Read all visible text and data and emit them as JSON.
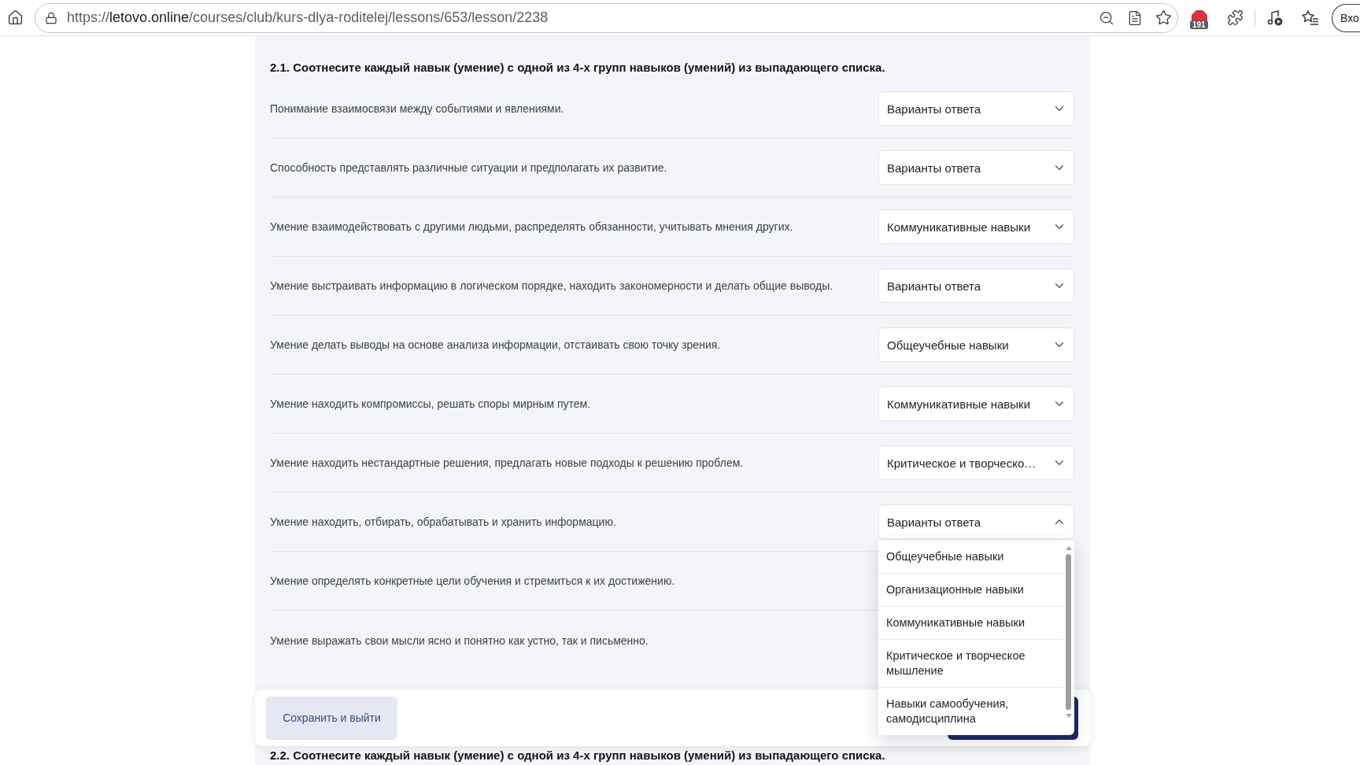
{
  "browser": {
    "url": {
      "scheme": "https://",
      "host": "letovo.online",
      "path": "/courses/club/kurs-dlya-roditelej/lessons/653/lesson/2238"
    },
    "extension_badge": "191",
    "profile_button": "Вхо"
  },
  "section": {
    "title": "2.1. Соотнесите каждый навык (умение) с одной из 4-х групп навыков (умений) из выпадающего списка.",
    "rows": [
      {
        "text": "Понимание взаимосвязи между событиями и явлениями.",
        "select": {
          "value": "Варианты ответа",
          "expanded": false
        }
      },
      {
        "text": "Способность представлять различные ситуации и предполагать их развитие.",
        "select": {
          "value": "Варианты ответа",
          "expanded": false
        }
      },
      {
        "text": "Умение взаимодействовать с другими людьми, распределять обязанности, учитывать мнения других.",
        "select": {
          "value": "Коммуникативные навыки",
          "expanded": false
        }
      },
      {
        "text": "Умение выстраивать информацию в логическом порядке, находить закономерности и делать общие выводы.",
        "select": {
          "value": "Варианты ответа",
          "expanded": false
        }
      },
      {
        "text": "Умение делать выводы на основе анализа информации, отстаивать свою точку зрения.",
        "select": {
          "value": "Общеучебные навыки",
          "expanded": false
        }
      },
      {
        "text": "Умение находить компромиссы, решать споры мирным путем.",
        "select": {
          "value": "Коммуникативные навыки",
          "expanded": false
        }
      },
      {
        "text": "Умение находить нестандартные решения, предлагать новые подходы к решению проблем.",
        "select": {
          "value": "Критическое и творческо…",
          "expanded": false
        }
      },
      {
        "text": "Умение находить, отбирать, обрабатывать и хранить информацию.",
        "select": {
          "value": "Варианты ответа",
          "expanded": true,
          "options": [
            {
              "label": "Общеучебные навыки",
              "selected": false
            },
            {
              "label": "Организационные навыки",
              "selected": false
            },
            {
              "label": "Коммуникативные навыки",
              "selected": false
            },
            {
              "label": "Критическое и творческое мышление",
              "selected": false
            },
            {
              "label": "Навыки самообучения, самодисциплина",
              "selected": false
            }
          ]
        }
      },
      {
        "text": "Умение определять конкретные цели обучения и стремиться к их достижению."
      },
      {
        "text": "Умение выражать свои мысли ясно и понятно как устно, так и письменно."
      }
    ]
  },
  "save_bar": {
    "buttons": [
      {
        "kind": "secondary",
        "label": "Сохранить и выйти"
      },
      {
        "kind": "primary"
      }
    ]
  },
  "next_section": {
    "title": "2.2. Соотнесите каждый навык (умение) с одной из 4-х групп навыков (умений) из выпадающего списка."
  }
}
